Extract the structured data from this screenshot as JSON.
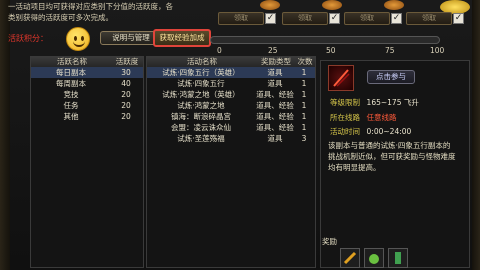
{
  "description": [
    "一活动项目均可获得对应类别下分值的活跃度，各",
    "类别获得的活跃度可多次完成。"
  ],
  "claim": {
    "label": "领取"
  },
  "activity_label": "活跃积分：",
  "buttons": {
    "help": "说明与管理",
    "exp": "获取经验加成"
  },
  "progress": {
    "value": 0,
    "ticks": [
      "0",
      "25",
      "50",
      "75",
      "100"
    ]
  },
  "left_table": {
    "headers": [
      "活跃名称",
      "活跃度"
    ],
    "rows": [
      {
        "name": "每日副本",
        "value": "30"
      },
      {
        "name": "每周副本",
        "value": "40"
      },
      {
        "name": "竞技",
        "value": "20"
      },
      {
        "name": "任务",
        "value": "20"
      },
      {
        "name": "其他",
        "value": "20"
      }
    ]
  },
  "mid_table": {
    "headers": [
      "活动名称",
      "奖励类型",
      "次数"
    ],
    "rows": [
      {
        "name": "试炼·四象五行（英雄）",
        "type": "道具",
        "count": "1"
      },
      {
        "name": "试炼·四象五行",
        "type": "道具",
        "count": "1"
      },
      {
        "name": "试炼·鸿蒙之地（英雄）",
        "type": "道具、经验",
        "count": "1"
      },
      {
        "name": "试炼·鸿蒙之地",
        "type": "道具、经验",
        "count": "1"
      },
      {
        "name": "镇海：断浪碎晶宫",
        "type": "道具、经验",
        "count": "1"
      },
      {
        "name": "会盟：凌云诛众仙",
        "type": "道具、经验",
        "count": "1"
      },
      {
        "name": "试炼·圣莲殇福",
        "type": "道具",
        "count": "3"
      }
    ]
  },
  "detail": {
    "link": "点击参与",
    "level_key": "等级限制",
    "level_val": "165~175 飞升",
    "route_key": "所在线路",
    "route_val": "任意线路",
    "time_key": "活动时间",
    "time_val": "0:00~24:00",
    "text": "该副本与普通的试炼·四象五行副本的挑战机制近似，但可获奖励与怪物难度均有明显提高。",
    "reward_label": "奖励"
  }
}
